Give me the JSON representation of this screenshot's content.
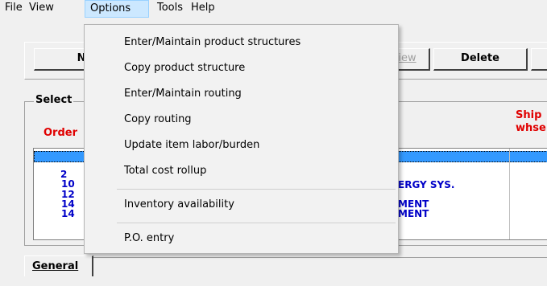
{
  "menubar": {
    "items": [
      {
        "label": "File"
      },
      {
        "label": "View"
      },
      {
        "label": "Options"
      },
      {
        "label": "Tools"
      },
      {
        "label": "Help"
      }
    ]
  },
  "toolbar": {
    "new_label": "Ne",
    "view_label": "iew",
    "delete_label": "Delete"
  },
  "groupbox": {
    "title": "Select"
  },
  "columns": {
    "order": "Order",
    "ship_line1": "Ship",
    "ship_line2": "whse"
  },
  "grid": {
    "order_fragments": [
      "2",
      "10",
      "12",
      "14",
      "14"
    ],
    "desc_fragments": [
      "ERGY SYS.",
      "MENT",
      "MENT"
    ]
  },
  "tabs": {
    "general_label": "General"
  },
  "options_menu": {
    "items": [
      "Enter/Maintain product structures",
      "Copy product structure",
      "Enter/Maintain routing",
      "Copy routing",
      "Update item labor/burden",
      "Total cost rollup",
      "Inventory availability",
      "P.O. entry"
    ]
  },
  "colors": {
    "menu_active_bg": "#cce8ff",
    "header_red": "#e00000",
    "grid_text_blue": "#0000c8",
    "selection_blue": "#3399ff"
  }
}
